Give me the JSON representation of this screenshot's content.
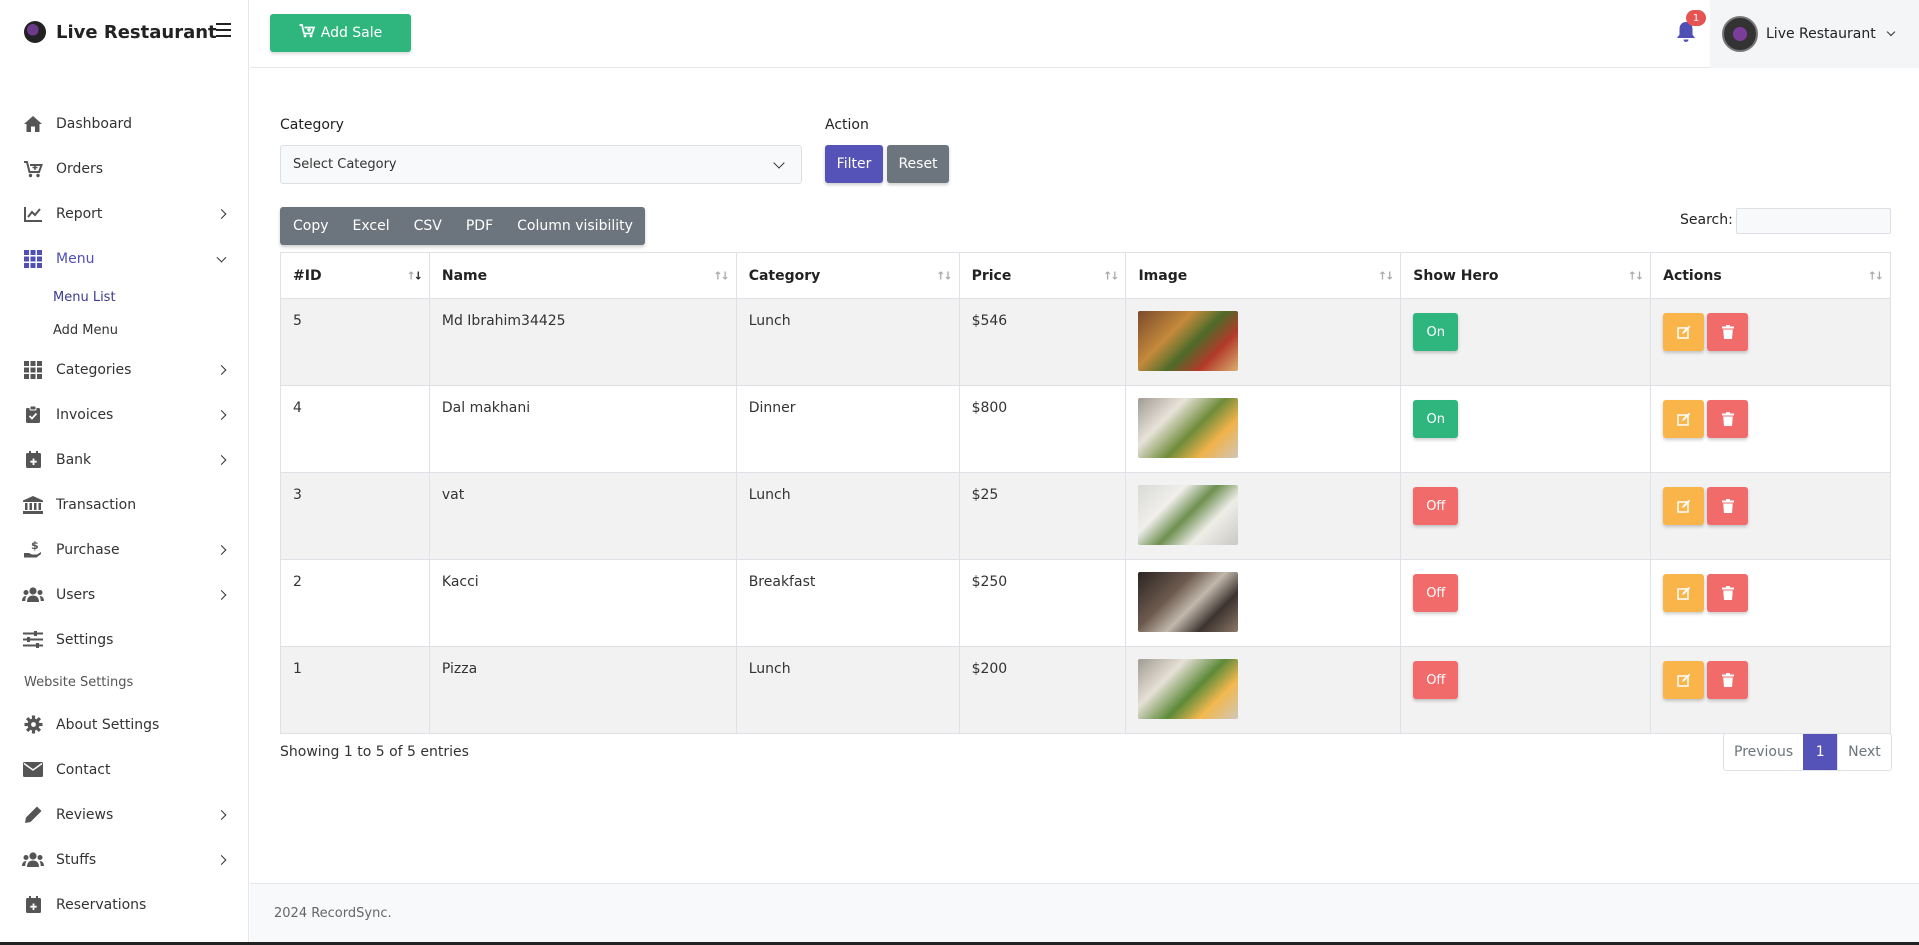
{
  "brand": {
    "title": "Live Restaurant"
  },
  "sidebar": {
    "items": [
      {
        "label": "Dashboard",
        "icon": "home-icon"
      },
      {
        "label": "Orders",
        "icon": "cart-icon"
      },
      {
        "label": "Report",
        "icon": "chart-line-icon"
      },
      {
        "label": "Menu",
        "icon": "grid-icon"
      },
      {
        "label": "Categories",
        "icon": "grid-icon"
      },
      {
        "label": "Invoices",
        "icon": "clipboard-check-icon"
      },
      {
        "label": "Bank",
        "icon": "calendar-plus-icon"
      },
      {
        "label": "Transaction",
        "icon": "bank-icon"
      },
      {
        "label": "Purchase",
        "icon": "hand-dollar-icon"
      },
      {
        "label": "Users",
        "icon": "users-icon"
      },
      {
        "label": "Settings",
        "icon": "sliders-icon"
      },
      {
        "label": "About Settings",
        "icon": "gear-icon"
      },
      {
        "label": "Contact",
        "icon": "envelope-icon"
      },
      {
        "label": "Reviews",
        "icon": "pencil-icon"
      },
      {
        "label": "Stuffs",
        "icon": "users-icon"
      },
      {
        "label": "Reservations",
        "icon": "calendar-plus-icon"
      }
    ],
    "menu_sub": [
      "Menu List",
      "Add Menu"
    ],
    "website_heading": "Website Settings"
  },
  "topbar": {
    "add_sale_label": "Add Sale",
    "notification_count": "1",
    "user_name": "Live Restaurant"
  },
  "filters": {
    "category_label": "Category",
    "category_value": "Select Category",
    "action_label": "Action",
    "filter_button": "Filter",
    "reset_button": "Reset"
  },
  "export_buttons": [
    "Copy",
    "Excel",
    "CSV",
    "PDF",
    "Column visibility"
  ],
  "search": {
    "label": "Search:",
    "value": ""
  },
  "table": {
    "columns": [
      "#ID",
      "Name",
      "Category",
      "Price",
      "Image",
      "Show Hero",
      "Actions"
    ],
    "rows": [
      {
        "id": "5",
        "name": "Md Ibrahim34425",
        "category": "Lunch",
        "price": "$546",
        "image": "burger-fries-photo",
        "hero": "On"
      },
      {
        "id": "4",
        "name": "Dal makhani",
        "category": "Dinner",
        "price": "$800",
        "image": "plated-dish-photo",
        "hero": "On"
      },
      {
        "id": "3",
        "name": "vat",
        "category": "Lunch",
        "price": "$25",
        "image": "salad-bowls-photo",
        "hero": "Off"
      },
      {
        "id": "2",
        "name": "Kacci",
        "category": "Breakfast",
        "price": "$250",
        "image": "dark-table-food-photo",
        "hero": "Off"
      },
      {
        "id": "1",
        "name": "Pizza",
        "category": "Lunch",
        "price": "$200",
        "image": "plated-dish-photo",
        "hero": "Off"
      }
    ]
  },
  "pagination": {
    "info": "Showing 1 to 5 of 5 entries",
    "previous": "Previous",
    "current": "1",
    "next": "Next"
  },
  "footer": {
    "text": "2024 RecordSync."
  },
  "colors": {
    "primary": "#5553b7",
    "success": "#2fb57e",
    "danger": "#f26b6b",
    "warning": "#f9b44a",
    "secondary": "#6c757d"
  }
}
